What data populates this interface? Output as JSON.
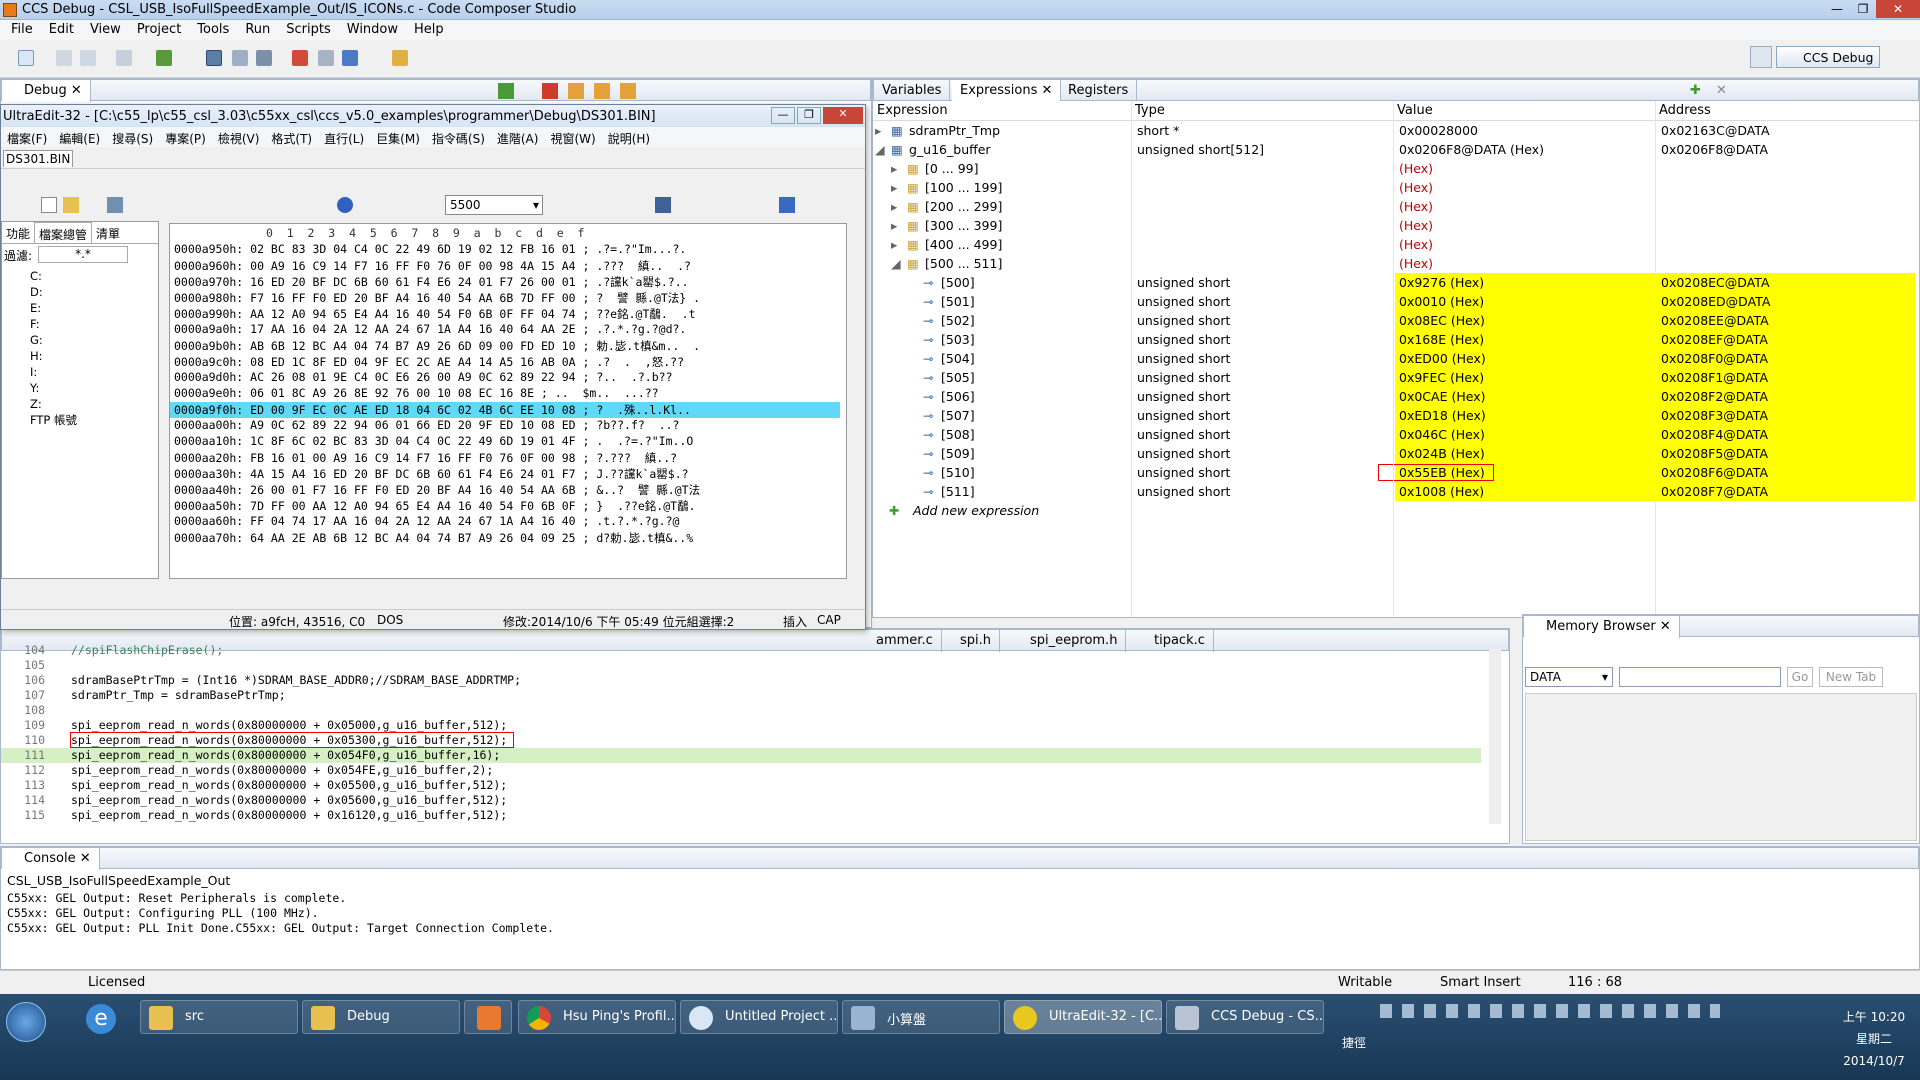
{
  "app": {
    "title": "CCS Debug - CSL_USB_IsoFullSpeedExample_Out/IS_ICONs.c - Code Composer Studio",
    "menu": [
      "File",
      "Edit",
      "View",
      "Project",
      "Tools",
      "Run",
      "Scripts",
      "Window",
      "Help"
    ],
    "perspective": "CCS Debug"
  },
  "debug_panel": {
    "tab": "Debug"
  },
  "ultraedit": {
    "title": "UltraEdit-32 - [C:\\c55_lp\\c55_csl_3.03\\c55xx_csl\\ccs_v5.0_examples\\programmer\\Debug\\DS301.BIN]",
    "menu": [
      "檔案(F)",
      "編輯(E)",
      "搜尋(S)",
      "專案(P)",
      "檢視(V)",
      "格式(T)",
      "直行(L)",
      "巨集(M)",
      "指令碼(S)",
      "進階(A)",
      "視窗(W)",
      "說明(H)"
    ],
    "file_tab": "DS301.BIN",
    "goto_value": "5500",
    "side_tabs": [
      "功能",
      "檔案總管",
      "清單"
    ],
    "filter_label": "過濾:",
    "filter_value": "*.*",
    "drives": [
      "C:",
      "D:",
      "E:",
      "F:",
      "G:",
      "H:",
      "I:",
      "Y:",
      "Z:",
      "FTP 帳號"
    ],
    "hex_header": "0  1  2  3  4  5  6  7  8  9  a  b  c  d  e  f",
    "hex_lines": [
      "0000a950h: 02 BC 83 3D 04 C4 0C 22 49 6D 19 02 12 FB 16 01 ; .?=.?\"Im...?.",
      "0000a960h: 00 A9 16 C9 14 F7 16 FF F0 76 0F 00 98 4A 15 A4 ; .???  縝..  .?",
      "0000a970h: 16 ED 20 BF DC 6B 60 61 F4 E6 24 01 F7 26 00 01 ; .?讜k`a罌$.?..",
      "0000a980h: F7 16 FF F0 ED 20 BF A4 16 40 54 AA 6B 7D FF 00 ; ?  譬 縣.@T法} .",
      "0000a990h: AA 12 A0 94 65 E4 A4 16 40 54 F0 6B 0F FF 04 74 ; ??e銘.@T鷸.  .t",
      "0000a9a0h: 17 AA 16 04 2A 12 AA 24 67 1A A4 16 40 64 AA 2E ; .?.*.?g.?@d?.",
      "0000a9b0h: AB 6B 12 BC A4 04 74 B7 A9 26 6D 09 00 FD ED 10 ; 勅.毖.t槙&m..  .",
      "0000a9c0h: 08 ED 1C 8F ED 04 9F EC 2C AE A4 14 A5 16 AB 0A ; .?  .  ,怒.??",
      "0000a9d0h: AC 26 08 01 9E C4 0C E6 26 00 A9 0C 62 89 22 94 ; ?..  .?.b??",
      "0000a9e0h: 06 01 8C A9 26 8E 92 76 00 10 08 EC 16 8E ; ..  $m..  ...??",
      "0000a9f0h: ED 00 9F EC 0C AE ED 18 04 6C 02 4B 6C EE 10 08 ; ?  .殊..l.Kl..",
      "0000aa00h: A9 0C 62 89 22 94 06 01 66 ED 20 9F ED 10 08 ED ; ?b??.f?  ..?",
      "0000aa10h: 1C 8F 6C 02 BC 83 3D 04 C4 0C 22 49 6D 19 01 4F ; .  .?=.?\"Im..O",
      "0000aa20h: FB 16 01 00 A9 16 C9 14 F7 16 FF F0 76 0F 00 98 ; ?.???  縝..?",
      "0000aa30h: 4A 15 A4 16 ED 20 BF DC 6B 60 61 F4 E6 24 01 F7 ; J.??讜k`a罌$.?",
      "0000aa40h: 26 00 01 F7 16 FF F0 ED 20 BF A4 16 40 54 AA 6B ; &..?  譬 縣.@T法",
      "0000aa50h: 7D FF 00 AA 12 A0 94 65 E4 A4 16 40 54 F0 6B 0F ; }  .??e銘.@T鷸.",
      "0000aa60h: FF 04 74 17 AA 16 04 2A 12 AA 24 67 1A A4 16 40 ; .t.?.*.?g.?@",
      "0000aa70h: 64 AA 2E AB 6B 12 BC A4 04 74 B7 A9 26 04 09 25 ; d?勅.毖.t槙&..%"
    ],
    "status": {
      "pos": "位置: a9fcH, 43516, C0",
      "mode": "DOS",
      "modified": "修改:2014/10/6 下午 05:49 位元組選擇:2",
      "insert": "插入",
      "caps": "CAP"
    }
  },
  "expressions": {
    "tabs": [
      "Variables",
      "Expressions",
      "Registers"
    ],
    "columns": [
      "Expression",
      "Type",
      "Value",
      "Address"
    ],
    "rows": [
      {
        "name": "sdramPtr_Tmp",
        "type": "short *",
        "value": "0x00028000",
        "address": "0x02163C@DATA",
        "indent": 0
      },
      {
        "name": "g_u16_buffer",
        "type": "unsigned short[512]",
        "value": "0x0206F8@DATA (Hex)",
        "address": "0x0206F8@DATA",
        "indent": 0
      },
      {
        "name": "[0 ... 99]",
        "type": "",
        "value": "(Hex)",
        "address": "",
        "indent": 1
      },
      {
        "name": "[100 ... 199]",
        "type": "",
        "value": "(Hex)",
        "address": "",
        "indent": 1
      },
      {
        "name": "[200 ... 299]",
        "type": "",
        "value": "(Hex)",
        "address": "",
        "indent": 1
      },
      {
        "name": "[300 ... 399]",
        "type": "",
        "value": "(Hex)",
        "address": "",
        "indent": 1
      },
      {
        "name": "[400 ... 499]",
        "type": "",
        "value": "(Hex)",
        "address": "",
        "indent": 1
      },
      {
        "name": "[500 ... 511]",
        "type": "",
        "value": "(Hex)",
        "address": "",
        "indent": 1
      },
      {
        "name": "[500]",
        "type": "unsigned short",
        "value": "0x9276 (Hex)",
        "address": "0x0208EC@DATA",
        "indent": 2
      },
      {
        "name": "[501]",
        "type": "unsigned short",
        "value": "0x0010 (Hex)",
        "address": "0x0208ED@DATA",
        "indent": 2
      },
      {
        "name": "[502]",
        "type": "unsigned short",
        "value": "0x08EC (Hex)",
        "address": "0x0208EE@DATA",
        "indent": 2
      },
      {
        "name": "[503]",
        "type": "unsigned short",
        "value": "0x168E (Hex)",
        "address": "0x0208EF@DATA",
        "indent": 2
      },
      {
        "name": "[504]",
        "type": "unsigned short",
        "value": "0xED00 (Hex)",
        "address": "0x0208F0@DATA",
        "indent": 2
      },
      {
        "name": "[505]",
        "type": "unsigned short",
        "value": "0x9FEC (Hex)",
        "address": "0x0208F1@DATA",
        "indent": 2
      },
      {
        "name": "[506]",
        "type": "unsigned short",
        "value": "0x0CAE (Hex)",
        "address": "0x0208F2@DATA",
        "indent": 2
      },
      {
        "name": "[507]",
        "type": "unsigned short",
        "value": "0xED18 (Hex)",
        "address": "0x0208F3@DATA",
        "indent": 2
      },
      {
        "name": "[508]",
        "type": "unsigned short",
        "value": "0x046C (Hex)",
        "address": "0x0208F4@DATA",
        "indent": 2
      },
      {
        "name": "[509]",
        "type": "unsigned short",
        "value": "0x024B (Hex)",
        "address": "0x0208F5@DATA",
        "indent": 2
      },
      {
        "name": "[510]",
        "type": "unsigned short",
        "value": "0x55EB (Hex)",
        "address": "0x0208F6@DATA",
        "indent": 2
      },
      {
        "name": "[511]",
        "type": "unsigned short",
        "value": "0x1008 (Hex)",
        "address": "0x0208F7@DATA",
        "indent": 2
      }
    ],
    "add_new": "Add new expression"
  },
  "editor": {
    "tabs": [
      "ammer.c",
      "spi.h",
      "spi_eeprom.h",
      "tipack.c"
    ],
    "lines": [
      {
        "n": "104",
        "t": "//spiFlashChipErase();"
      },
      {
        "n": "105",
        "t": ""
      },
      {
        "n": "106",
        "t": "sdramBasePtrTmp = (Int16 *)SDRAM_BASE_ADDR0;//SDRAM_BASE_ADDRTMP;"
      },
      {
        "n": "107",
        "t": "sdramPtr_Tmp = sdramBasePtrTmp;"
      },
      {
        "n": "108",
        "t": ""
      },
      {
        "n": "109",
        "t": "spi_eeprom_read_n_words(0x80000000 + 0x05000,g_u16_buffer,512);"
      },
      {
        "n": "110",
        "t": "spi_eeprom_read_n_words(0x80000000 + 0x05300,g_u16_buffer,512);"
      },
      {
        "n": "111",
        "t": "spi_eeprom_read_n_words(0x80000000 + 0x054F0,g_u16_buffer,16);"
      },
      {
        "n": "112",
        "t": "spi_eeprom_read_n_words(0x80000000 + 0x054FE,g_u16_buffer,2);"
      },
      {
        "n": "113",
        "t": "spi_eeprom_read_n_words(0x80000000 + 0x05500,g_u16_buffer,512);"
      },
      {
        "n": "114",
        "t": "spi_eeprom_read_n_words(0x80000000 + 0x05600,g_u16_buffer,512);"
      },
      {
        "n": "115",
        "t": "spi_eeprom_read_n_words(0x80000000 + 0x16120,g_u16_buffer,512);"
      }
    ]
  },
  "memory_browser": {
    "tab": "Memory Browser",
    "page": "DATA",
    "go": "Go",
    "new_tab": "New Tab"
  },
  "console": {
    "tab": "Console",
    "project": "CSL_USB_IsoFullSpeedExample_Out",
    "lines": [
      "C55xx: GEL Output: Reset Peripherals is complete.",
      "C55xx: GEL Output: Configuring PLL (100 MHz).",
      "C55xx: GEL Output: PLL Init Done.C55xx: GEL Output: Target Connection Complete."
    ]
  },
  "status": {
    "licensed": "Licensed",
    "writable": "Writable",
    "insert": "Smart Insert",
    "position": "116 : 68"
  },
  "taskbar": {
    "items": [
      "src",
      "Debug",
      "",
      "Hsu Ping's Profil...",
      "Untitled Project ...",
      "小算盤",
      "UltraEdit-32 - [C...",
      "CCS Debug - CS..."
    ],
    "ime": "捷徑",
    "time": "上午 10:20",
    "weekday": "星期二",
    "date": "2014/10/7"
  }
}
